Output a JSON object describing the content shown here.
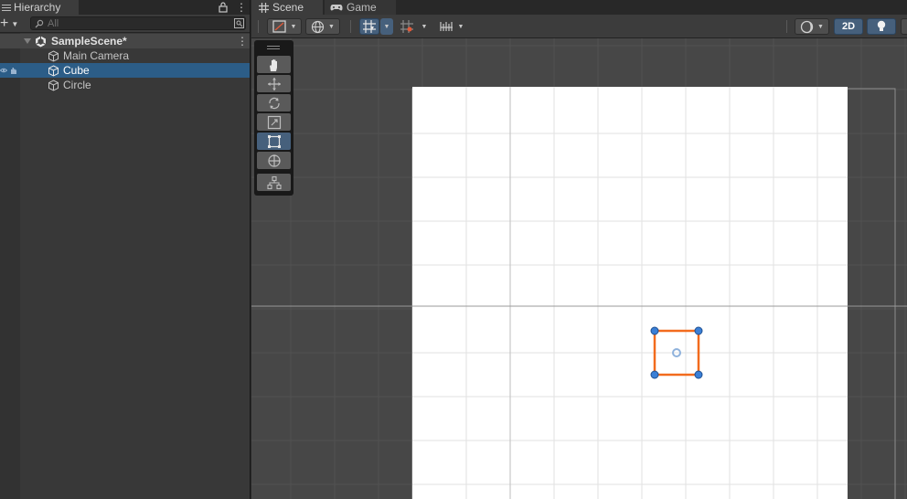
{
  "hierarchy": {
    "tab_label": "Hierarchy",
    "search_placeholder": "All",
    "scene_name": "SampleScene*",
    "items": [
      {
        "label": "Main Camera",
        "selected": false
      },
      {
        "label": "Cube",
        "selected": true
      },
      {
        "label": "Circle",
        "selected": false
      }
    ]
  },
  "scene_view": {
    "tabs": [
      {
        "label": "Scene",
        "icon": "grid-icon",
        "active": true
      },
      {
        "label": "Game",
        "icon": "gamepad-icon",
        "active": false
      }
    ],
    "toolbar": {
      "draw_mode_icon": "draw-mode-icon",
      "gizmo_space_icon": "globe-icon",
      "grid_snap_icon": "grid-snap-icon",
      "snap_increment_icon": "snap-increment-icon",
      "ruler_icon": "ruler-icon",
      "shading_icon": "shading-icon",
      "mode_2d_label": "2D",
      "lighting_icon": "lightbulb-icon"
    },
    "tools": [
      "hand-icon",
      "move-icon",
      "rotate-icon",
      "scale-icon",
      "rect-transform-icon",
      "transform-icon",
      "custom-tool-icon"
    ],
    "active_tool": "rect-transform-icon"
  },
  "colors": {
    "selection": "#2c5d87",
    "accent_active": "#46607c",
    "selection_outline": "#f26b1d",
    "handle": "#3a7fd6",
    "canvas": "#ffffff"
  }
}
